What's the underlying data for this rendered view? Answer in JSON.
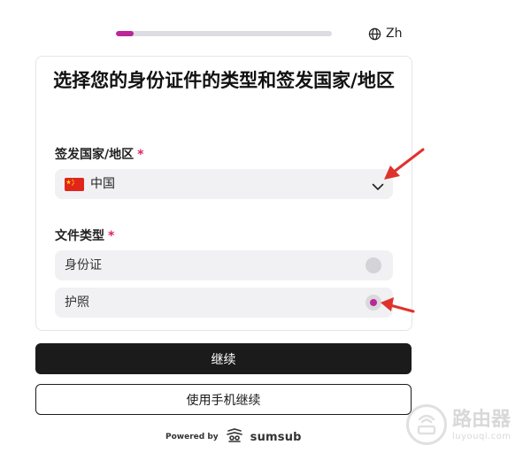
{
  "progress": {
    "fraction": 0.08
  },
  "language": {
    "label": "Zh",
    "icon": "globe-icon"
  },
  "title": "选择您的身份证件的类型和签发国家/地区",
  "issuing_country": {
    "label": "签发国家/地区",
    "required_mark": "*",
    "selected_value": "中国",
    "flag_icon": "china-flag-icon"
  },
  "document_type": {
    "label": "文件类型",
    "required_mark": "*",
    "options": [
      {
        "label": "身份证",
        "selected": false
      },
      {
        "label": "护照",
        "selected": true
      }
    ]
  },
  "buttons": {
    "continue": "继续",
    "continue_on_phone": "使用手机继续"
  },
  "footer": {
    "powered_by": "Powered by",
    "brand": "sumsub"
  },
  "watermark": {
    "title": "路由器",
    "subtitle": "luyouqi.com"
  },
  "colors": {
    "accent": "#b9279a",
    "annotation_red": "#e0322d",
    "primary_button": "#1b1b1c"
  }
}
